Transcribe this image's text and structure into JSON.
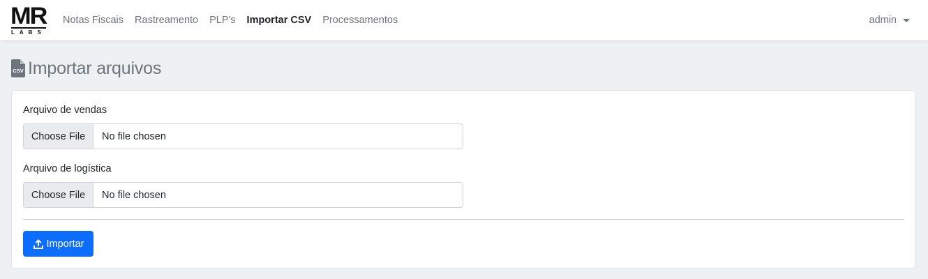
{
  "brand": {
    "logo_main": "MR",
    "logo_sub": "LABS"
  },
  "nav": {
    "items": [
      {
        "label": "Notas Fiscais",
        "active": false
      },
      {
        "label": "Rastreamento",
        "active": false
      },
      {
        "label": "PLP's",
        "active": false
      },
      {
        "label": "Importar CSV",
        "active": true
      },
      {
        "label": "Processamentos",
        "active": false
      }
    ],
    "user": "admin"
  },
  "page": {
    "title": "Importar arquivos",
    "icon": "csv-file-icon",
    "icon_text": "CSV"
  },
  "form": {
    "sales_file": {
      "label": "Arquivo de vendas",
      "button": "Choose File",
      "value": "No file chosen"
    },
    "logistics_file": {
      "label": "Arquivo de logística",
      "button": "Choose File",
      "value": "No file chosen"
    },
    "submit": {
      "label": "Importar",
      "icon": "upload-icon"
    }
  },
  "colors": {
    "primary": "#0d6efd",
    "background": "#eef1f4",
    "muted_text": "#6c757d"
  }
}
